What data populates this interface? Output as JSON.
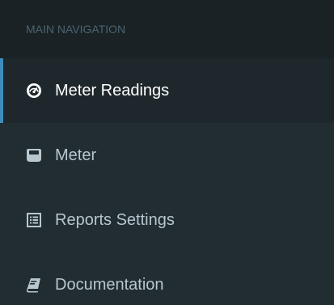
{
  "sidebar": {
    "header": "MAIN NAVIGATION",
    "items": [
      {
        "label": "Meter Readings",
        "icon": "dashboard-icon",
        "active": true
      },
      {
        "label": "Meter",
        "icon": "hdd-icon",
        "active": false
      },
      {
        "label": "Reports Settings",
        "icon": "list-alt-icon",
        "active": false
      },
      {
        "label": "Documentation",
        "icon": "book-icon",
        "active": false
      }
    ]
  },
  "colors": {
    "background": "#222d32",
    "header_background": "#1a2226",
    "active_background": "#1e282c",
    "accent": "#3c8dbc",
    "text": "#b8c7ce",
    "active_text": "#ffffff"
  }
}
